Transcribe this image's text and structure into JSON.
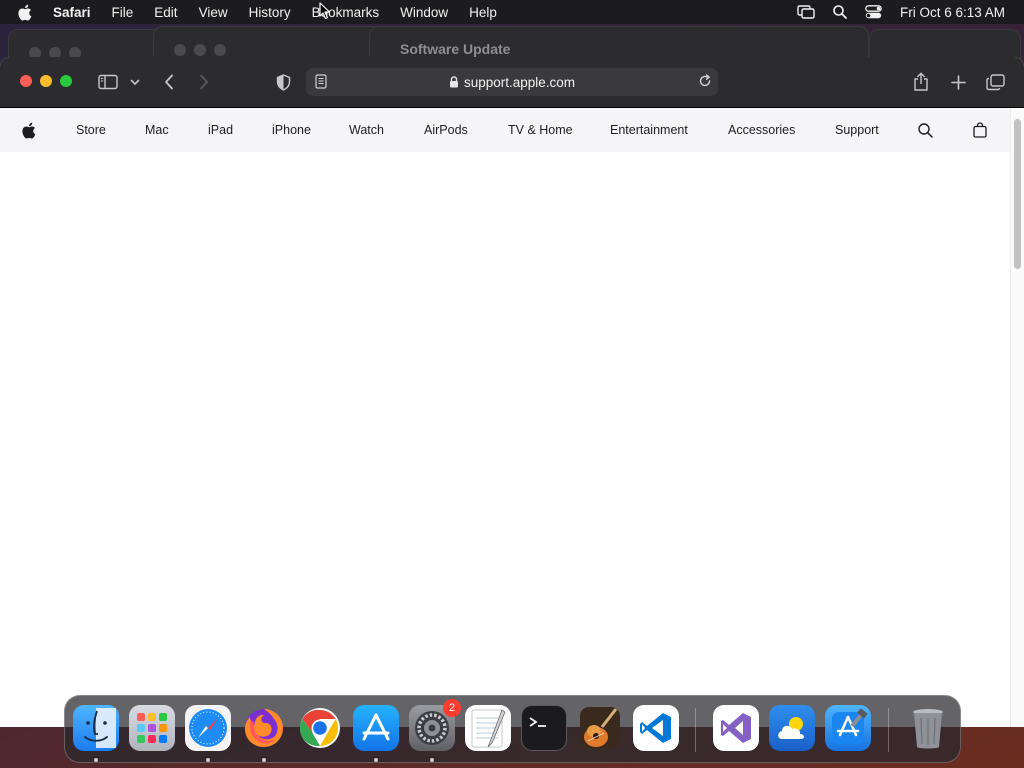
{
  "menubar": {
    "app_name": "Safari",
    "items": [
      "File",
      "Edit",
      "View",
      "History",
      "Bookmarks",
      "Window",
      "Help"
    ],
    "clock": "Fri Oct 6  6:13 AM"
  },
  "background_window": {
    "title": "Software Update"
  },
  "safari": {
    "address": "support.apple.com"
  },
  "globalnav": {
    "items": [
      "Store",
      "Mac",
      "iPad",
      "iPhone",
      "Watch",
      "AirPods",
      "TV & Home",
      "Entertainment",
      "Accessories",
      "Support"
    ]
  },
  "dock": {
    "apps": [
      {
        "name": "Finder",
        "icon": "finder-icon",
        "running": true
      },
      {
        "name": "Launchpad",
        "icon": "launchpad-icon",
        "running": false
      },
      {
        "name": "Safari",
        "icon": "safari-icon",
        "running": true
      },
      {
        "name": "Firefox",
        "icon": "firefox-icon",
        "running": true
      },
      {
        "name": "Google Chrome",
        "icon": "chrome-icon",
        "running": false
      },
      {
        "name": "App Store",
        "icon": "app-store-icon",
        "running": true
      },
      {
        "name": "System Settings",
        "icon": "system-settings-icon",
        "running": true,
        "badge": "2"
      },
      {
        "name": "TextEdit",
        "icon": "textedit-icon",
        "running": false
      },
      {
        "name": "Terminal",
        "icon": "terminal-icon",
        "running": false
      },
      {
        "name": "GarageBand",
        "icon": "garageband-icon",
        "running": false
      },
      {
        "name": "Visual Studio Code",
        "icon": "vscode-icon",
        "running": false
      },
      {
        "name": "Visual Studio",
        "icon": "visual-studio-icon",
        "running": false
      },
      {
        "name": "Weather",
        "icon": "weather-icon",
        "running": false
      },
      {
        "name": "Xcode",
        "icon": "xcode-icon",
        "running": false
      },
      {
        "name": "Trash",
        "icon": "trash-icon",
        "running": false
      }
    ]
  },
  "colors": {
    "menubar_bg": "#1c1c1e",
    "toolbar_bg": "#2c2c2e",
    "globalnav_bg": "#f5f5f7",
    "close": "#fe5f57",
    "minimize": "#febc2e",
    "maximize": "#28c840",
    "badge": "#ff3b30"
  }
}
